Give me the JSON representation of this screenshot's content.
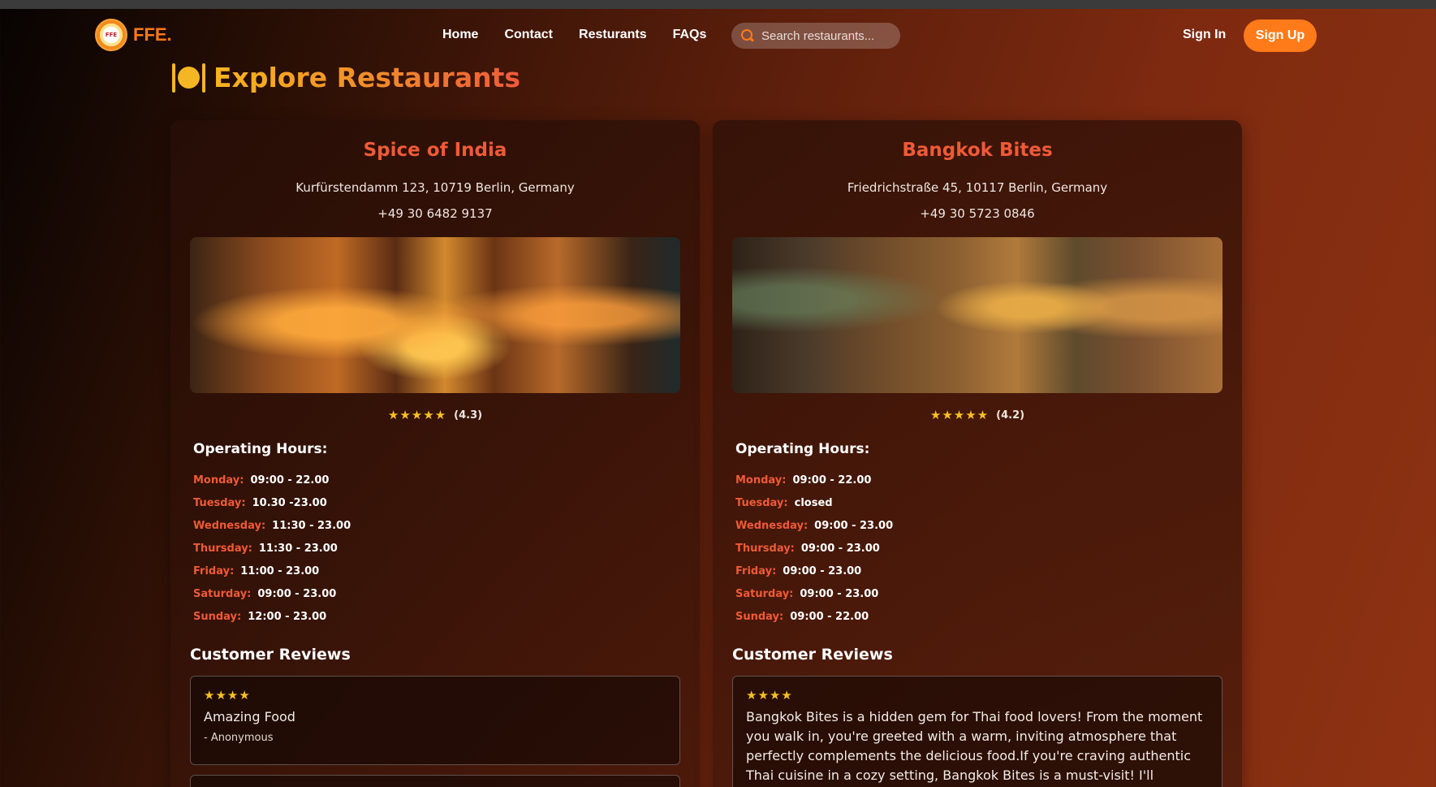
{
  "brand": {
    "name": "FFE.",
    "logo_text": "FFE"
  },
  "nav": {
    "links": [
      "Home",
      "Contact",
      "Resturants",
      "FAQs"
    ],
    "search_placeholder": "Search restaurants...",
    "sign_in": "Sign In",
    "sign_up": "Sign Up"
  },
  "page": {
    "title": "Explore Restaurants",
    "title_icon": "plate-cutlery-icon"
  },
  "colors": {
    "accent": "#ff7a18",
    "name": "#ef5a37",
    "star": "#f6c026"
  },
  "restaurants": [
    {
      "name": "Spice of India",
      "address": "Kurfürstendamm 123, 10719 Berlin, Germany",
      "phone": "+49 30 6482 9137",
      "stars": "★★★★★",
      "rating": "(4.3)",
      "hours_title": "Operating Hours:",
      "hours": [
        {
          "day": "Monday:",
          "time": "09:00 - 22.00"
        },
        {
          "day": "Tuesday:",
          "time": "10.30 -23.00"
        },
        {
          "day": "Wednesday:",
          "time": "11:30 - 23.00"
        },
        {
          "day": "Thursday:",
          "time": "11:30 - 23.00"
        },
        {
          "day": "Friday:",
          "time": "11:00 - 23.00"
        },
        {
          "day": "Saturday:",
          "time": "09:00 - 23.00"
        },
        {
          "day": "Sunday:",
          "time": "12:00 - 23.00"
        }
      ],
      "reviews_title": "Customer Reviews",
      "reviews": [
        {
          "stars": "★★★★",
          "text": "Amazing Food",
          "author": "- Anonymous"
        }
      ]
    },
    {
      "name": "Bangkok Bites",
      "address": "Friedrichstraße 45, 10117 Berlin, Germany",
      "phone": "+49 30 5723 0846",
      "stars": "★★★★★",
      "rating": "(4.2)",
      "hours_title": "Operating Hours:",
      "hours": [
        {
          "day": "Monday:",
          "time": "09:00 - 22.00"
        },
        {
          "day": "Tuesday:",
          "time": "closed"
        },
        {
          "day": "Wednesday:",
          "time": "09:00 - 23.00"
        },
        {
          "day": "Thursday:",
          "time": "09:00 - 23.00"
        },
        {
          "day": "Friday:",
          "time": "09:00 - 23.00"
        },
        {
          "day": "Saturday:",
          "time": "09:00 - 23.00"
        },
        {
          "day": "Sunday:",
          "time": "09:00 - 22.00"
        }
      ],
      "reviews_title": "Customer Reviews",
      "reviews": [
        {
          "stars": "★★★★",
          "text": "Bangkok Bites is a hidden gem for Thai food lovers! From the moment you walk in, you're greeted with a warm, inviting atmosphere that perfectly complements the delicious food.If you're craving authentic Thai cuisine in a cozy setting, Bangkok Bites is a must-visit! I'll definitely be coming back to"
        }
      ]
    }
  ]
}
